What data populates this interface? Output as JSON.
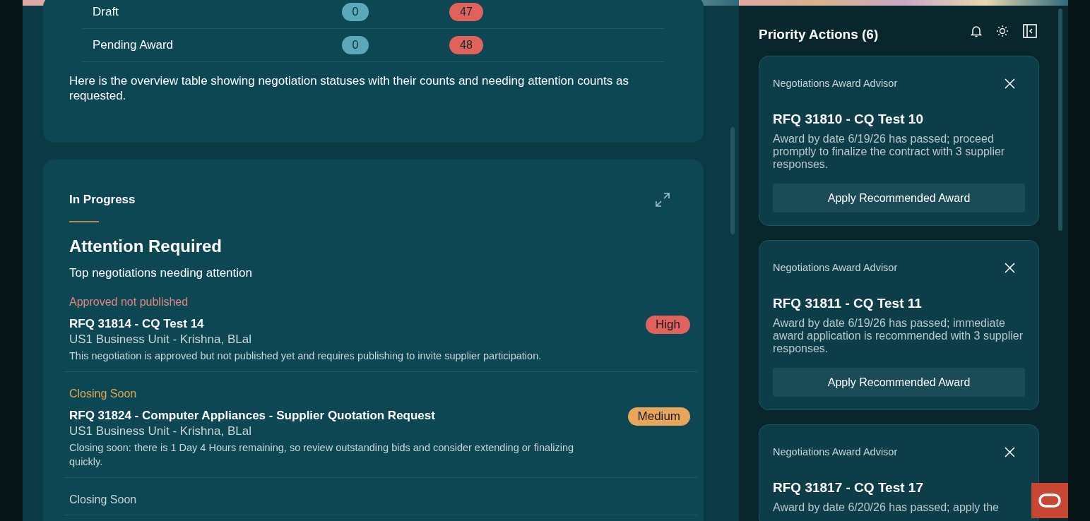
{
  "overview": {
    "rows": [
      {
        "status": "Draft",
        "count": "0",
        "attention": "47"
      },
      {
        "status": "Pending Award",
        "count": "0",
        "attention": "48"
      }
    ],
    "summary": "Here is the overview table showing negotiation statuses with their counts and needing attention counts as requested."
  },
  "attention": {
    "section": "In Progress",
    "title": "Attention Required",
    "subtitle": "Top negotiations needing attention",
    "items": [
      {
        "category": {
          "label": "Approved not published",
          "color": "#e8867c"
        },
        "title": "RFQ 31814 - CQ Test 14",
        "unit": "US1 Business Unit - Krishna, BLal",
        "description": "This negotiation is approved but not published yet and requires publishing to invite supplier participation.",
        "priority": {
          "label": "High",
          "color": "#e0625c"
        }
      },
      {
        "category": {
          "label": "Closing Soon",
          "color": "#e0a555"
        },
        "title": "RFQ 31824 - Computer Appliances - Supplier Quotation Request",
        "unit": "US1 Business Unit - Krishna, BLal",
        "description": "Closing soon: there is 1 Day 4 Hours remaining, so review outstanding bids and consider extending or finalizing quickly.",
        "priority": {
          "label": "Medium",
          "color": "#e8a65a"
        }
      },
      {
        "category": {
          "label": "Closing Soon",
          "color": "#c8d2d5"
        }
      }
    ]
  },
  "priority_actions": {
    "title": "Priority Actions (6)",
    "cards": [
      {
        "source": "Negotiations Award Advisor",
        "title": "RFQ 31810 - CQ Test 10",
        "description": "Award by date 6/19/26 has passed; proceed promptly to finalize the contract with 3 supplier responses.",
        "action": "Apply Recommended Award"
      },
      {
        "source": "Negotiations Award Advisor",
        "title": "RFQ 31811 - CQ Test 11",
        "description": "Award by date 6/19/26 has passed; immediate award application is recommended with 3 supplier responses.",
        "action": "Apply Recommended Award"
      },
      {
        "source": "Negotiations Award Advisor",
        "title": "RFQ 31817 - CQ Test 17",
        "description": "Award by date 6/20/26 has passed; apply the"
      }
    ]
  }
}
